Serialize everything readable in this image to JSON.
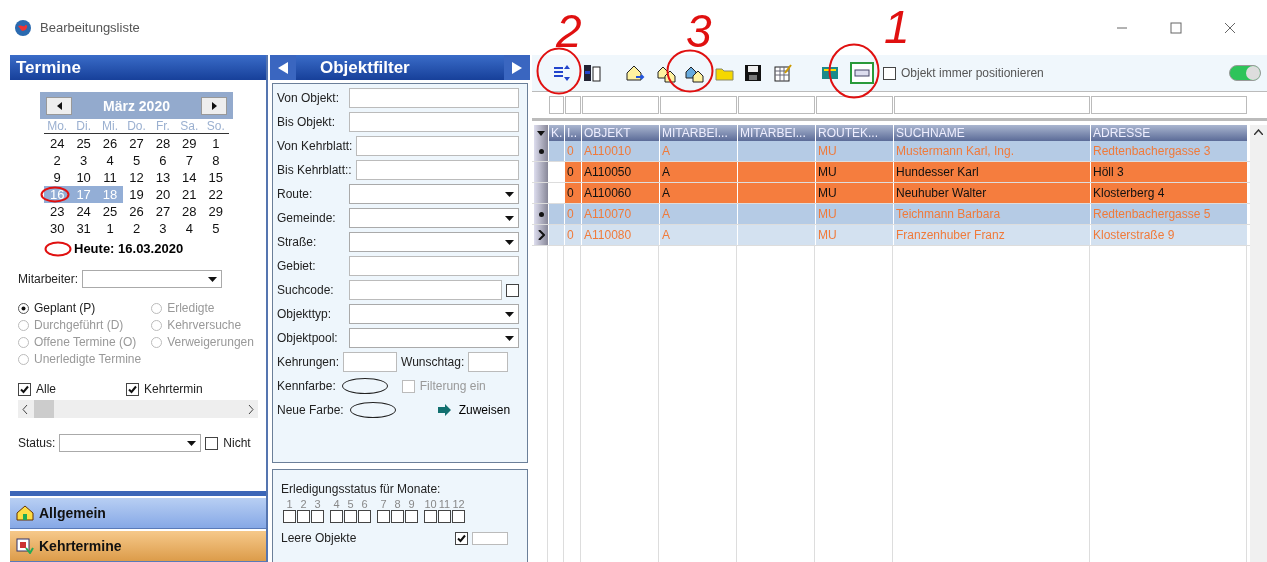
{
  "window": {
    "title": "Bearbeitungsliste"
  },
  "annotations": [
    {
      "label": "2"
    },
    {
      "label": "3"
    },
    {
      "label": "1"
    }
  ],
  "termine": {
    "title": "Termine",
    "calendar": {
      "month": "März 2020",
      "weekdays": [
        "Mo.",
        "Di.",
        "Mi.",
        "Do.",
        "Fr.",
        "Sa.",
        "So."
      ],
      "days": [
        {
          "label": "24",
          "selected": false
        },
        {
          "label": "25",
          "selected": false
        },
        {
          "label": "26",
          "selected": false
        },
        {
          "label": "27",
          "selected": false
        },
        {
          "label": "28",
          "selected": false
        },
        {
          "label": "29",
          "selected": false
        },
        {
          "label": "1",
          "selected": false
        },
        {
          "label": "2",
          "selected": false
        },
        {
          "label": "3",
          "selected": false
        },
        {
          "label": "4",
          "selected": false
        },
        {
          "label": "5",
          "selected": false
        },
        {
          "label": "6",
          "selected": false
        },
        {
          "label": "7",
          "selected": false
        },
        {
          "label": "8",
          "selected": false
        },
        {
          "label": "9",
          "selected": false
        },
        {
          "label": "10",
          "selected": false
        },
        {
          "label": "11",
          "selected": false
        },
        {
          "label": "12",
          "selected": false
        },
        {
          "label": "13",
          "selected": false
        },
        {
          "label": "14",
          "selected": false
        },
        {
          "label": "15",
          "selected": false
        },
        {
          "label": "16",
          "selected": true
        },
        {
          "label": "17",
          "selected": true
        },
        {
          "label": "18",
          "selected": true
        },
        {
          "label": "19",
          "selected": false
        },
        {
          "label": "20",
          "selected": false
        },
        {
          "label": "21",
          "selected": false
        },
        {
          "label": "22",
          "selected": false
        },
        {
          "label": "23",
          "selected": false
        },
        {
          "label": "24",
          "selected": false
        },
        {
          "label": "25",
          "selected": false
        },
        {
          "label": "26",
          "selected": false
        },
        {
          "label": "27",
          "selected": false
        },
        {
          "label": "28",
          "selected": false
        },
        {
          "label": "29",
          "selected": false
        },
        {
          "label": "30",
          "selected": false
        },
        {
          "label": "31",
          "selected": false
        },
        {
          "label": "1",
          "selected": false
        },
        {
          "label": "2",
          "selected": false
        },
        {
          "label": "3",
          "selected": false
        },
        {
          "label": "4",
          "selected": false
        },
        {
          "label": "5",
          "selected": false
        }
      ],
      "today": "Heute: 16.03.2020"
    },
    "mitarbeiter_label": "Mitarbeiter:",
    "radio_left": [
      {
        "label": "Geplant (P)",
        "selected": true,
        "disabled": false
      },
      {
        "label": "Durchgeführt (D)",
        "selected": false,
        "disabled": true
      },
      {
        "label": "Offene Termine (O)",
        "selected": false,
        "disabled": true
      },
      {
        "label": "Unerledigte Termine",
        "selected": false,
        "disabled": true
      }
    ],
    "radio_right": [
      {
        "label": "Erledigte",
        "selected": false,
        "disabled": true
      },
      {
        "label": "Kehrversuche",
        "selected": false,
        "disabled": true
      },
      {
        "label": "Verweigerungen",
        "selected": false,
        "disabled": true
      }
    ],
    "checkboxes": [
      {
        "label": "Alle",
        "checked": true
      },
      {
        "label": "Kehrtermin",
        "checked": true
      }
    ],
    "status_label": "Status:",
    "nicht": {
      "label": "Nicht",
      "checked": false
    },
    "nav": [
      {
        "label": "Allgemein",
        "selected": false
      },
      {
        "label": "Kehrtermine",
        "selected": true
      }
    ]
  },
  "objektfilter": {
    "title": "Objektfilter",
    "fields": [
      {
        "label": "Von Objekt:",
        "kind": "text"
      },
      {
        "label": "Bis Objekt:",
        "kind": "text"
      },
      {
        "label": "Von Kehrblatt:",
        "kind": "text"
      },
      {
        "label": "Bis Kehrblatt::",
        "kind": "text"
      },
      {
        "label": "Route:",
        "kind": "select"
      },
      {
        "label": "Gemeinde:",
        "kind": "select"
      },
      {
        "label": "Straße:",
        "kind": "select"
      },
      {
        "label": "Gebiet:",
        "kind": "text"
      },
      {
        "label": "Suchcode:",
        "kind": "check",
        "checked": false
      },
      {
        "label": "Objekttyp:",
        "kind": "select"
      },
      {
        "label": "Objektpool:",
        "kind": "select"
      }
    ],
    "kehrungen_label": "Kehrungen:",
    "wunschtag_label": "Wunschtag:",
    "kennfarbe_label": "Kennfarbe:",
    "filterung": {
      "label": "Filterung ein",
      "checked": false
    },
    "neue_farbe_label": "Neue Farbe:",
    "zuweisen": "Zuweisen",
    "status_title": "Erledigungsstatus für Monate:",
    "months": [
      {
        "label": "1",
        "checked": false
      },
      {
        "label": "2",
        "checked": false
      },
      {
        "label": "3",
        "checked": false
      },
      {
        "label": "4",
        "checked": false
      },
      {
        "label": "5",
        "checked": false
      },
      {
        "label": "6",
        "checked": false
      },
      {
        "label": "7",
        "checked": false
      },
      {
        "label": "8",
        "checked": false
      },
      {
        "label": "9",
        "checked": false
      },
      {
        "label": "10",
        "checked": false
      },
      {
        "label": "11",
        "checked": false
      },
      {
        "label": "12",
        "checked": false
      }
    ],
    "leere": {
      "label": "Leere Objekte",
      "checked": true
    }
  },
  "toolbar": {
    "position_check": {
      "label": "Objekt immer positionieren",
      "checked": false
    },
    "toggle": {
      "on": true
    }
  },
  "table": {
    "columns": [
      "K.",
      "I..",
      "OBJEKT",
      "MITARBEI...",
      "MITARBEI...",
      "ROUTEK...",
      "SUCHNAME",
      "ADRESSE"
    ],
    "rows": [
      {
        "selected": false,
        "highlighted": false,
        "i": "0",
        "objekt": "A110010",
        "mitarbei": "A",
        "routek": "MU",
        "suchname": "Mustermann Karl, Ing.",
        "adresse": "Redtenbachergasse 3"
      },
      {
        "selected": false,
        "highlighted": true,
        "i": "0",
        "objekt": "A110050",
        "mitarbei": "A",
        "routek": "MU",
        "suchname": "Hundesser Karl",
        "adresse": "Höll 3"
      },
      {
        "selected": false,
        "highlighted": true,
        "i": "0",
        "objekt": "A110060",
        "mitarbei": "A",
        "routek": "MU",
        "suchname": "Neuhuber Walter",
        "adresse": "Klosterberg 4"
      },
      {
        "selected": false,
        "highlighted": false,
        "i": "0",
        "objekt": "A110070",
        "mitarbei": "A",
        "routek": "MU",
        "suchname": "Teichmann Barbara",
        "adresse": "Redtenbachergasse 5"
      },
      {
        "selected": true,
        "highlighted": false,
        "i": "0",
        "objekt": "A110080",
        "mitarbei": "A",
        "routek": "MU",
        "suchname": "Franzenhuber Franz",
        "adresse": "Klosterstraße 9"
      }
    ]
  }
}
